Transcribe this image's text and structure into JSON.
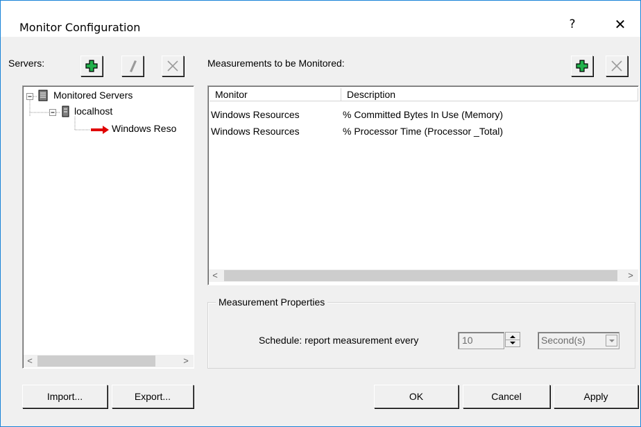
{
  "window": {
    "title": "Monitor Configuration",
    "help_label": "?",
    "close_label": "✕"
  },
  "servers": {
    "label": "Servers:",
    "tree": {
      "root": "Monitored Servers",
      "host": "localhost",
      "item": "Windows Reso"
    }
  },
  "measurements": {
    "label": "Measurements to be Monitored:",
    "columns": [
      "Monitor",
      "Description"
    ],
    "rows": [
      {
        "monitor": "Windows Resources",
        "description": "% Committed Bytes In Use (Memory)"
      },
      {
        "monitor": "Windows Resources",
        "description": "% Processor Time (Processor _Total)"
      }
    ]
  },
  "properties": {
    "group_title": "Measurement Properties",
    "schedule_label": "Schedule: report measurement every",
    "interval_value": "10",
    "unit_value": "Second(s)"
  },
  "scroll": {
    "left": "<",
    "right": ">"
  },
  "buttons": {
    "import": "Import...",
    "export": "Export...",
    "ok": "OK",
    "cancel": "Cancel",
    "apply": "Apply"
  },
  "colors": {
    "window_border": "#1883d7",
    "add_icon_fill": "#22b14c",
    "arrow_icon": "#e00000"
  },
  "icons": {
    "add": "plus-icon",
    "edit": "pencil-icon",
    "delete": "x-icon",
    "server_group": "server-group-icon",
    "server": "server-icon",
    "arrow": "red-arrow-icon"
  }
}
